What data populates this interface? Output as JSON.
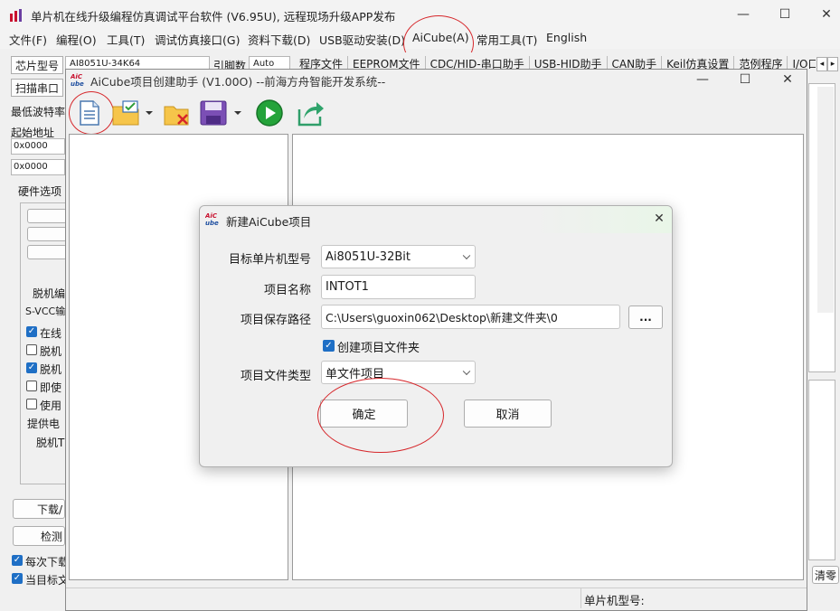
{
  "app": {
    "title": "单片机在线升级编程仿真调试平台软件 (V6.95U), 远程现场升级APP发布",
    "minimize": "—",
    "maximize": "☐",
    "close": "✕"
  },
  "menubar": {
    "items": [
      "文件(F)",
      "编程(O)",
      "工具(T)",
      "调试仿真接口(G)",
      "资料下载(D)",
      "USB驱动安装(D)",
      "AiCube(A)",
      "常用工具(T)",
      "English"
    ]
  },
  "main": {
    "chip_label": "芯片型号",
    "chip_value": "AI8051U-34K64",
    "pins_label": "引脚数",
    "pins_value": "Auto",
    "scan_label": "扫描串口",
    "min_baud_label": "最低波特率",
    "start_addr_label": "起始地址",
    "addr1": "0x0000",
    "addr2": "0x0000",
    "hw_options": "硬件选项",
    "opt_a": "脱机编",
    "opt_b": "S-VCC输",
    "chk1": "在线",
    "chk2": "脱机",
    "chk3": "脱机",
    "chk4": "即使",
    "chk5": "使用",
    "power_label": "提供电",
    "offline_label": "脱机T",
    "download_btn": "下载/",
    "detect_btn": "检测",
    "each_download": "每次下载",
    "current_target": "当目标文",
    "clear_btn": "清零",
    "tabs": [
      "程序文件",
      "EEPROM文件",
      "CDC/HID-串口助手",
      "USB-HID助手",
      "CAN助手",
      "Keil仿真设置",
      "范例程序",
      "I/O口配置"
    ],
    "tab_left": "◂",
    "tab_right": "▸"
  },
  "helper": {
    "title": "AiCube项目创建助手 (V1.00O) --前海方舟智能开发系统--",
    "status_label": "单片机型号:",
    "minimize": "—",
    "maximize": "☐",
    "close": "✕"
  },
  "dialog": {
    "title": "新建AiCube项目",
    "close": "✕",
    "mcu_label": "目标单片机型号",
    "mcu_value": "Ai8051U-32Bit",
    "name_label": "项目名称",
    "name_value": "INTOT1",
    "path_label": "项目保存路径",
    "path_value": "C:\\Users\\guoxin062\\Desktop\\新建文件夹\\0",
    "browse": "...",
    "create_folder": "创建项目文件夹",
    "create_folder_checked": true,
    "type_label": "项目文件类型",
    "type_value": "单文件项目",
    "ok": "确定",
    "cancel": "取消"
  },
  "colors": {
    "highlight": "#d6262a",
    "check": "#1f6fc5",
    "logo": "#c8102e"
  }
}
